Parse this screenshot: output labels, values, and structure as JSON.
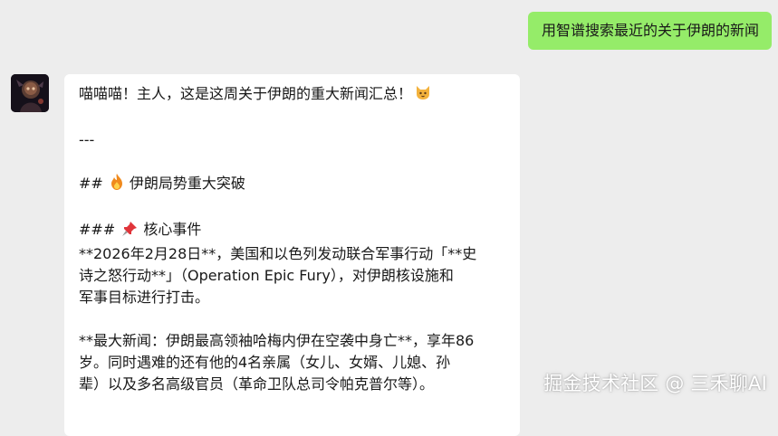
{
  "chat": {
    "user_message": "用智谱搜索最近的关于伊朗的新闻",
    "bot_message": {
      "greeting": "喵喵喵！主人，这是这周关于伊朗的重大新闻汇总！",
      "greeting_emoji": "cat-face-icon",
      "separator": "---",
      "h2_prefix": "##",
      "h2_emoji": "fire-icon",
      "h2_text": "伊朗局势重大突破",
      "h3_prefix": "###",
      "h3_emoji": "pushpin-icon",
      "h3_text": "核心事件",
      "p1_lines": [
        "**2026年2月28日**，美国和以色列发动联合军事行动「**史",
        "诗之怒行动**」（Operation Epic Fury），对伊朗核设施和",
        "军事目标进行打击。"
      ],
      "p2_lines": [
        "**最大新闻：伊朗最高领袖哈梅内伊在空袭中身亡**，享年86",
        "岁。同时遇难的还有他的4名亲属（女儿、女婿、儿媳、孙",
        "辈）以及多名高级官员（革命卫队总司令帕克普尔等）。"
      ]
    }
  },
  "watermark": "掘金技术社区 @ 三禾聊AI",
  "colors": {
    "background": "#ededed",
    "outgoing_bubble": "#95ec69",
    "incoming_bubble": "#ffffff",
    "text": "#191919"
  }
}
